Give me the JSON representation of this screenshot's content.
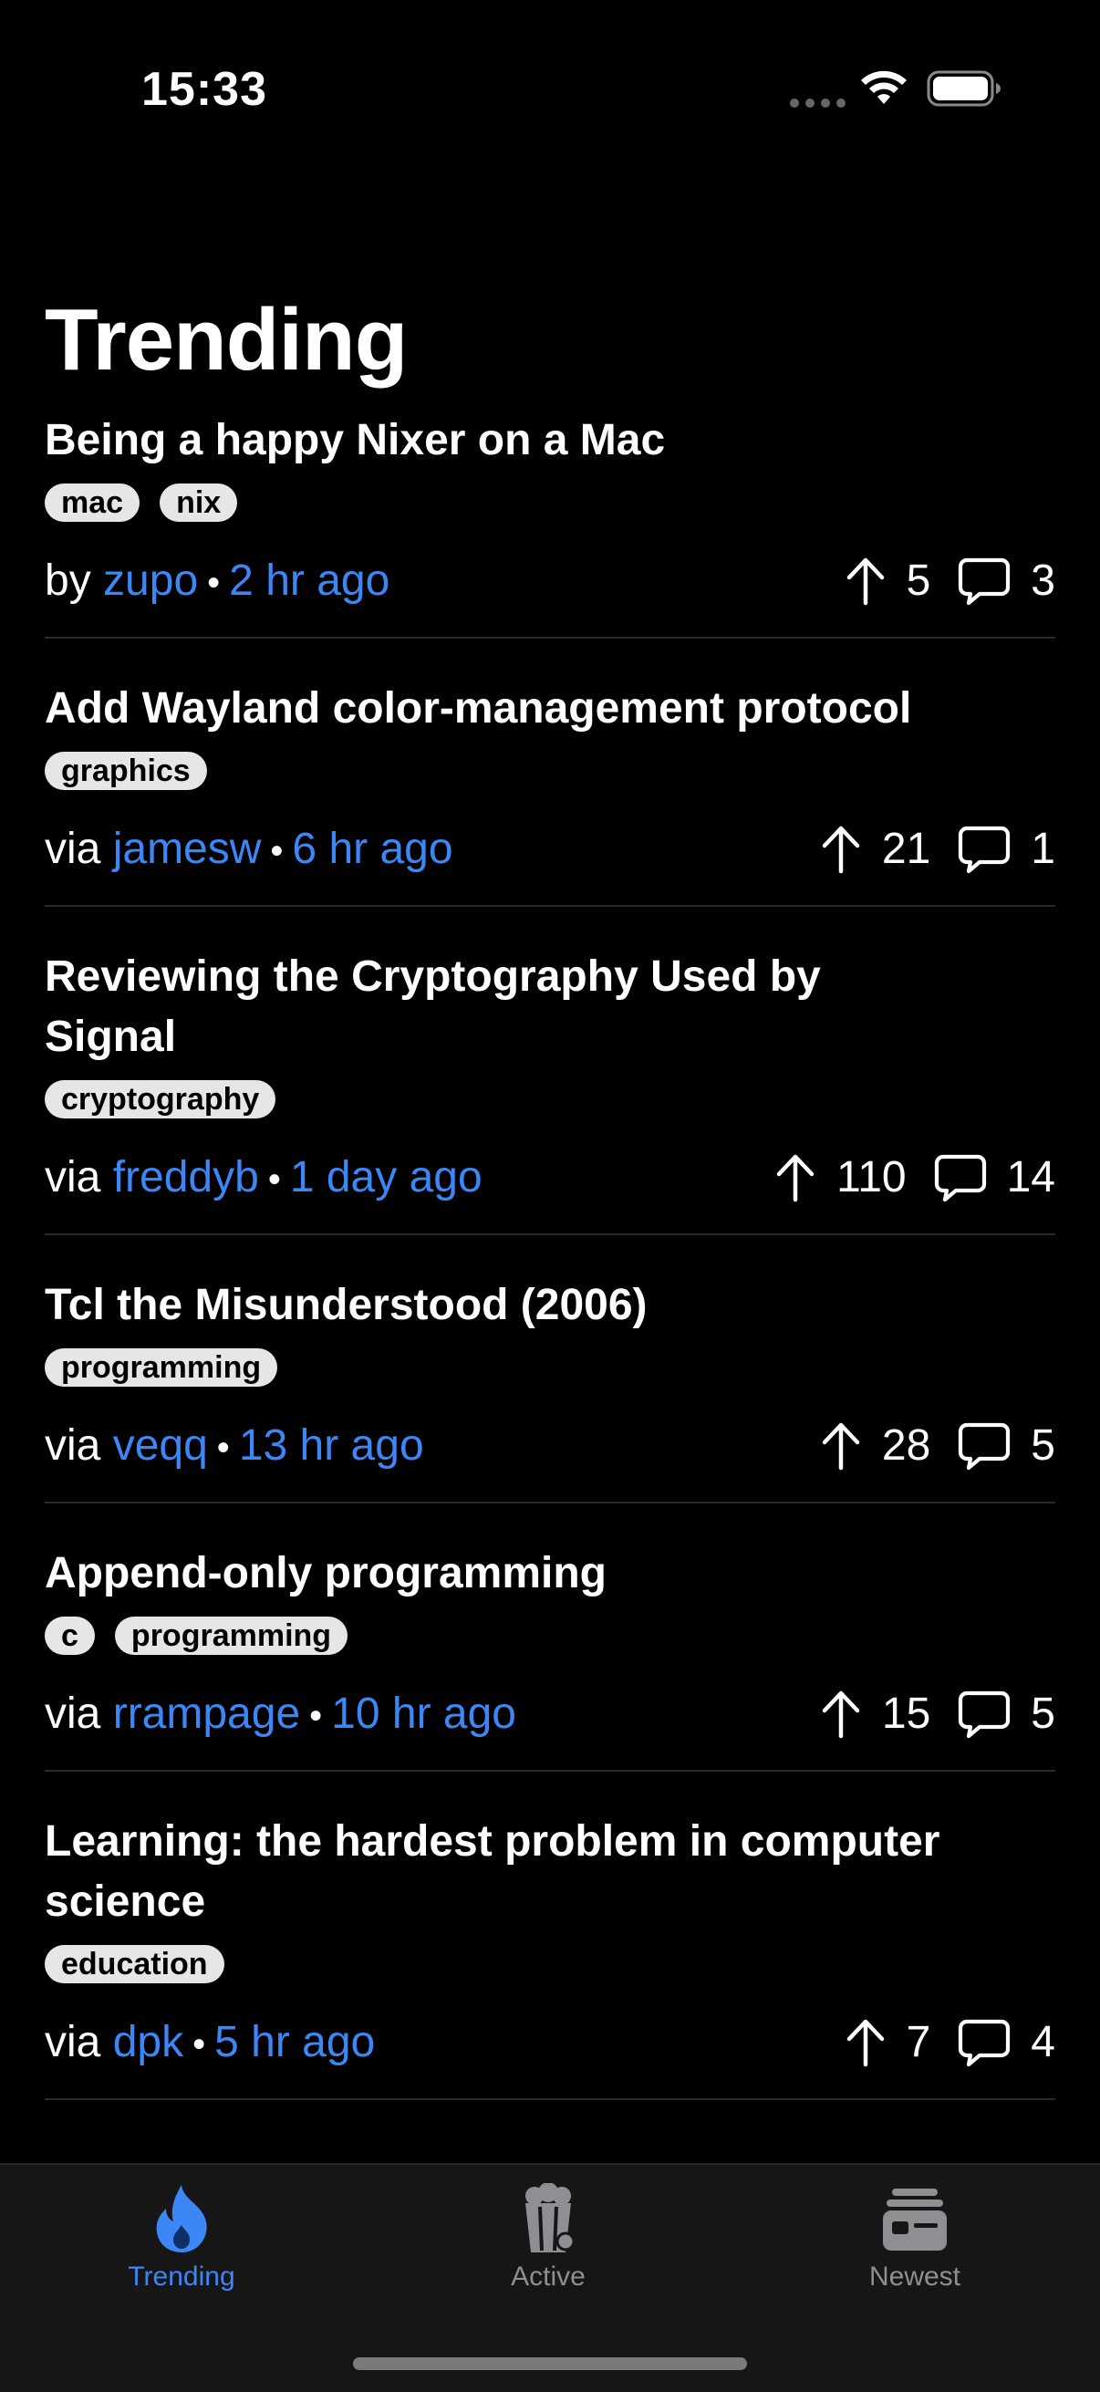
{
  "status_bar": {
    "time": "15:33"
  },
  "header": {
    "title": "Trending"
  },
  "stories": [
    {
      "title": "Being a happy Nixer on a Mac",
      "tags": [
        "mac",
        "nix"
      ],
      "prefix": "by",
      "user": "zupo",
      "time": "2 hr ago",
      "votes": "5",
      "comments": "3"
    },
    {
      "title": "Add Wayland color-management protocol",
      "tags": [
        "graphics"
      ],
      "prefix": "via",
      "user": "jamesw",
      "time": "6 hr ago",
      "votes": "21",
      "comments": "1"
    },
    {
      "title": "Reviewing the Cryptography Used by Signal",
      "tags": [
        "cryptography"
      ],
      "prefix": "via",
      "user": "freddyb",
      "time": "1 day ago",
      "votes": "110",
      "comments": "14"
    },
    {
      "title": "Tcl the Misunderstood (2006)",
      "tags": [
        "programming"
      ],
      "prefix": "via",
      "user": "veqq",
      "time": "13 hr ago",
      "votes": "28",
      "comments": "5"
    },
    {
      "title": "Append-only programming",
      "tags": [
        "c",
        "programming"
      ],
      "prefix": "via",
      "user": "rrampage",
      "time": "10 hr ago",
      "votes": "15",
      "comments": "5"
    },
    {
      "title": "Learning: the hardest problem in computer science",
      "tags": [
        "education"
      ],
      "prefix": "via",
      "user": "dpk",
      "time": "5 hr ago",
      "votes": "7",
      "comments": "4"
    }
  ],
  "tab_bar": {
    "tabs": [
      {
        "label": "Trending",
        "icon": "flame-icon",
        "active": true
      },
      {
        "label": "Active",
        "icon": "popcorn-icon",
        "active": false
      },
      {
        "label": "Newest",
        "icon": "newspaper-icon",
        "active": false
      }
    ]
  },
  "colors": {
    "accent": "#3c86f5",
    "background": "#000000",
    "tab_inactive": "#8e8e93",
    "tag_bg": "#e6e6e6"
  }
}
